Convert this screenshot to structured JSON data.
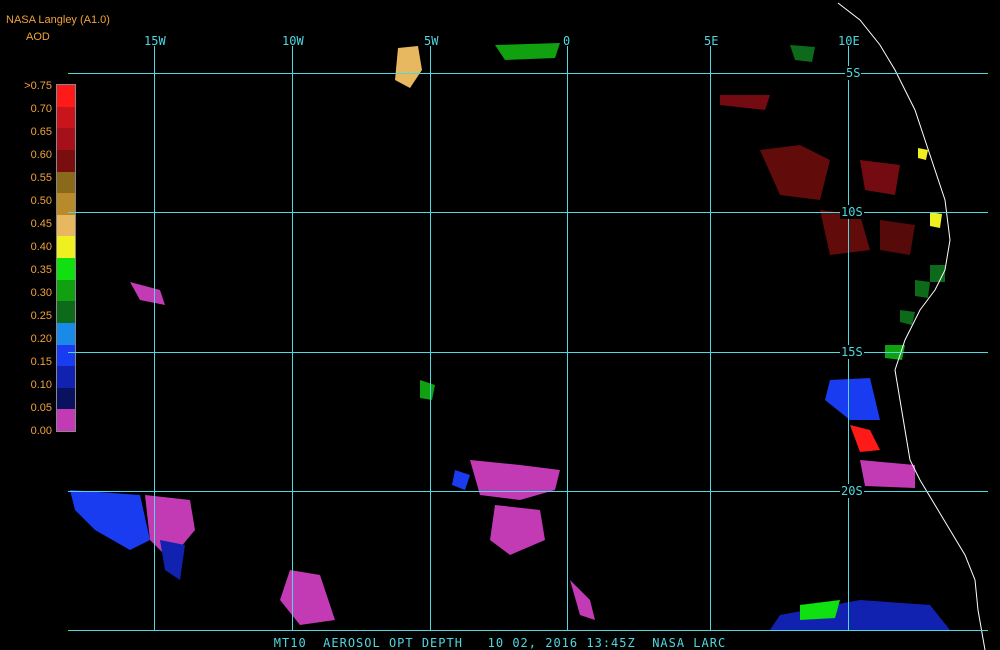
{
  "header": {
    "source": "NASA Langley (A1.0)",
    "product": "AOD"
  },
  "legend": {
    "labels": [
      ">0.75",
      "0.70",
      "0.65",
      "0.60",
      "0.55",
      "0.50",
      "0.45",
      "0.40",
      "0.35",
      "0.30",
      "0.25",
      "0.20",
      "0.15",
      "0.10",
      "0.05",
      "0.00"
    ],
    "colors": [
      "#ff1a1a",
      "#c8141a",
      "#a5101a",
      "#7a0e0e",
      "#8a6a1a",
      "#b88a2a",
      "#e8b860",
      "#f0f020",
      "#10e010",
      "#10a010",
      "#0d6a1a",
      "#1a8ae8",
      "#1a3cf0",
      "#1222b0",
      "#0a1260",
      "#c23ab4"
    ]
  },
  "grid": {
    "longitudes": [
      "15W",
      "10W",
      "5W",
      "0",
      "5E",
      "10E"
    ],
    "latitudes": [
      "5S",
      "10S",
      "15S",
      "20S"
    ],
    "color": "#4ed8e0"
  },
  "footer": {
    "product_code": "MT10",
    "title": "AEROSOL OPT DEPTH",
    "date": "10 02, 2016",
    "time": "13:45Z",
    "credit": "NASA LARC"
  }
}
